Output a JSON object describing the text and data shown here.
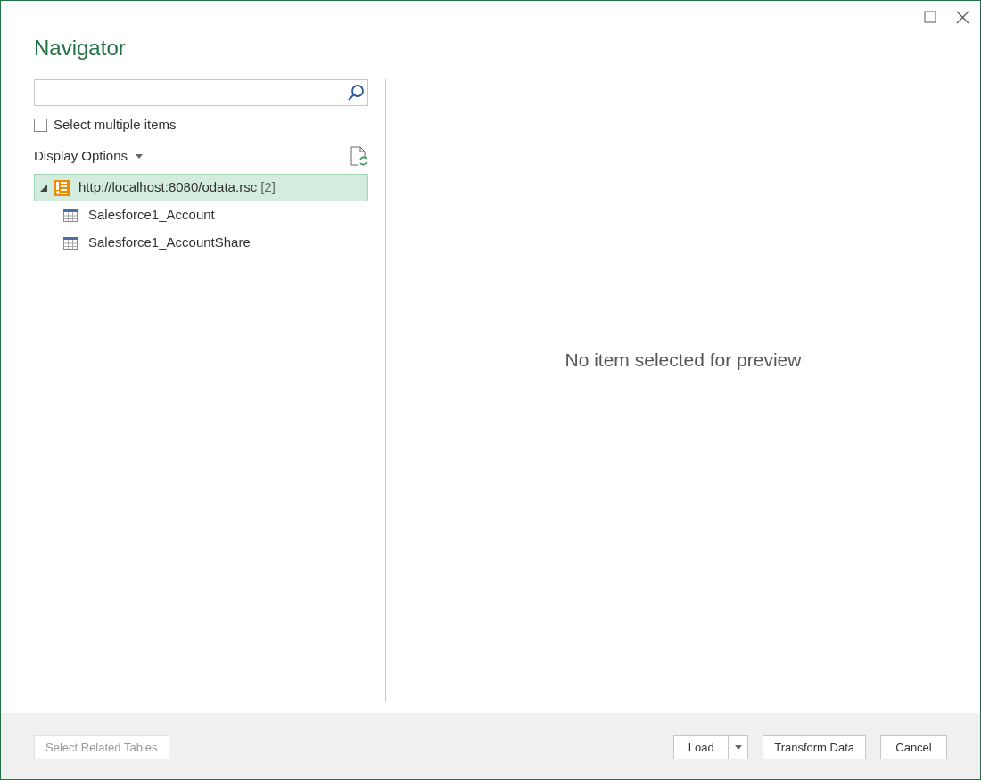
{
  "window": {
    "title": "Navigator"
  },
  "select_multiple": {
    "label": "Select multiple items",
    "checked": false
  },
  "display_options": {
    "label": "Display Options"
  },
  "tree": [
    {
      "label": "http://localhost:8080/odata.rsc",
      "count": "[2]",
      "expanded": true,
      "selected": true,
      "children": [
        {
          "label": "Salesforce1_Account",
          "selected": false
        },
        {
          "label": "Salesforce1_AccountShare",
          "selected": false
        }
      ]
    }
  ],
  "preview_message": "No item selected for preview",
  "footer": {
    "related": {
      "label": "Select Related Tables",
      "disabled": true
    },
    "buttons": [
      {
        "kind": "split",
        "label": "Load"
      },
      {
        "kind": "plain",
        "label": "Transform Data"
      },
      {
        "kind": "plain",
        "label": "Cancel"
      }
    ]
  }
}
